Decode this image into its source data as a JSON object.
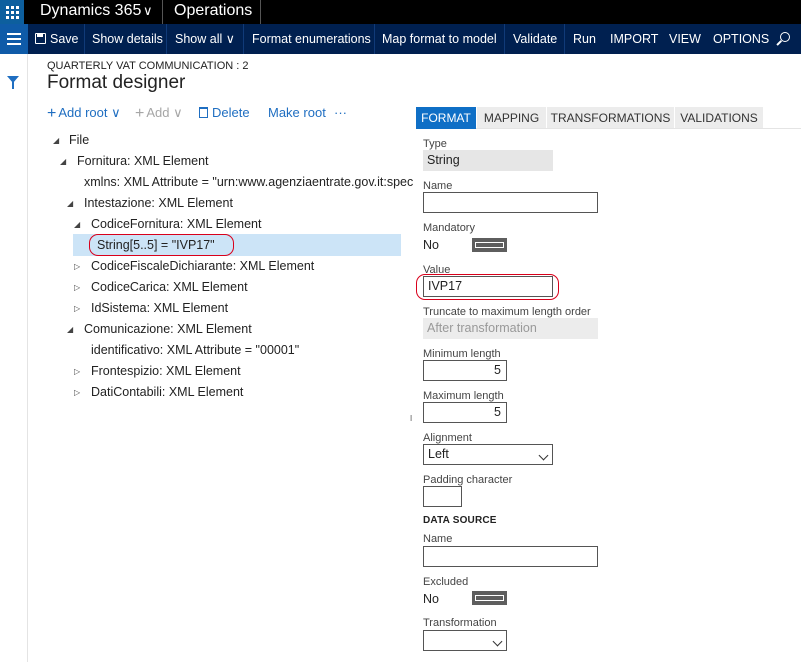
{
  "topbar": {
    "app_name": "Dynamics 365",
    "module": "Operations"
  },
  "actionbar": {
    "save": "Save",
    "show_details": "Show details",
    "show_all": "Show all",
    "format_enumerations": "Format enumerations",
    "map_format": "Map format to model",
    "validate": "Validate",
    "run": "Run",
    "import": "IMPORT",
    "view": "VIEW",
    "options": "OPTIONS"
  },
  "page": {
    "breadcrumb": "QUARTERLY VAT COMMUNICATION : 2",
    "title": "Format designer"
  },
  "toolbar": {
    "add_root": "Add root",
    "add": "Add",
    "delete": "Delete",
    "make_root": "Make root",
    "more": "···"
  },
  "tree": [
    {
      "label": "File",
      "toggle": "◢"
    },
    {
      "label": "Fornitura: XML Element",
      "toggle": "◢"
    },
    {
      "label": "xmlns: XML Attribute = \"urn:www.agenziaentrate.gov.it:spec",
      "toggle": ""
    },
    {
      "label": "Intestazione: XML Element",
      "toggle": "◢"
    },
    {
      "label": "CodiceFornitura: XML Element",
      "toggle": "◢"
    },
    {
      "label": "String[5..5] = \"IVP17\"",
      "toggle": ""
    },
    {
      "label": "CodiceFiscaleDichiarante: XML Element",
      "toggle": "▷"
    },
    {
      "label": "CodiceCarica: XML Element",
      "toggle": "▷"
    },
    {
      "label": "IdSistema: XML Element",
      "toggle": "▷"
    },
    {
      "label": "Comunicazione: XML Element",
      "toggle": "◢"
    },
    {
      "label": "identificativo: XML Attribute = \"00001\"",
      "toggle": ""
    },
    {
      "label": "Frontespizio: XML Element",
      "toggle": "▷"
    },
    {
      "label": "DatiContabili: XML Element",
      "toggle": "▷"
    }
  ],
  "tabs": [
    "FORMAT",
    "MAPPING",
    "TRANSFORMATIONS",
    "VALIDATIONS"
  ],
  "details": {
    "type_label": "Type",
    "type_value": "String",
    "name_label": "Name",
    "name_value": "",
    "mandatory_label": "Mandatory",
    "mandatory_value": "No",
    "value_label": "Value",
    "value_value": "IVP17",
    "truncate_label": "Truncate to maximum length order",
    "truncate_value": "After transformation",
    "min_length_label": "Minimum length",
    "min_length_value": "5",
    "max_length_label": "Maximum length",
    "max_length_value": "5",
    "alignment_label": "Alignment",
    "alignment_value": "Left",
    "padding_label": "Padding character",
    "padding_value": "",
    "data_source_heading": "DATA SOURCE",
    "ds_name_label": "Name",
    "ds_name_value": "",
    "excluded_label": "Excluded",
    "excluded_value": "No",
    "transformation_label": "Transformation",
    "transformation_value": ""
  },
  "colors": {
    "topbar": "#000000",
    "actionbar": "#002050",
    "accent": "#0f6fc6",
    "selection": "#cce4f7",
    "annotation": "#d9001b"
  }
}
